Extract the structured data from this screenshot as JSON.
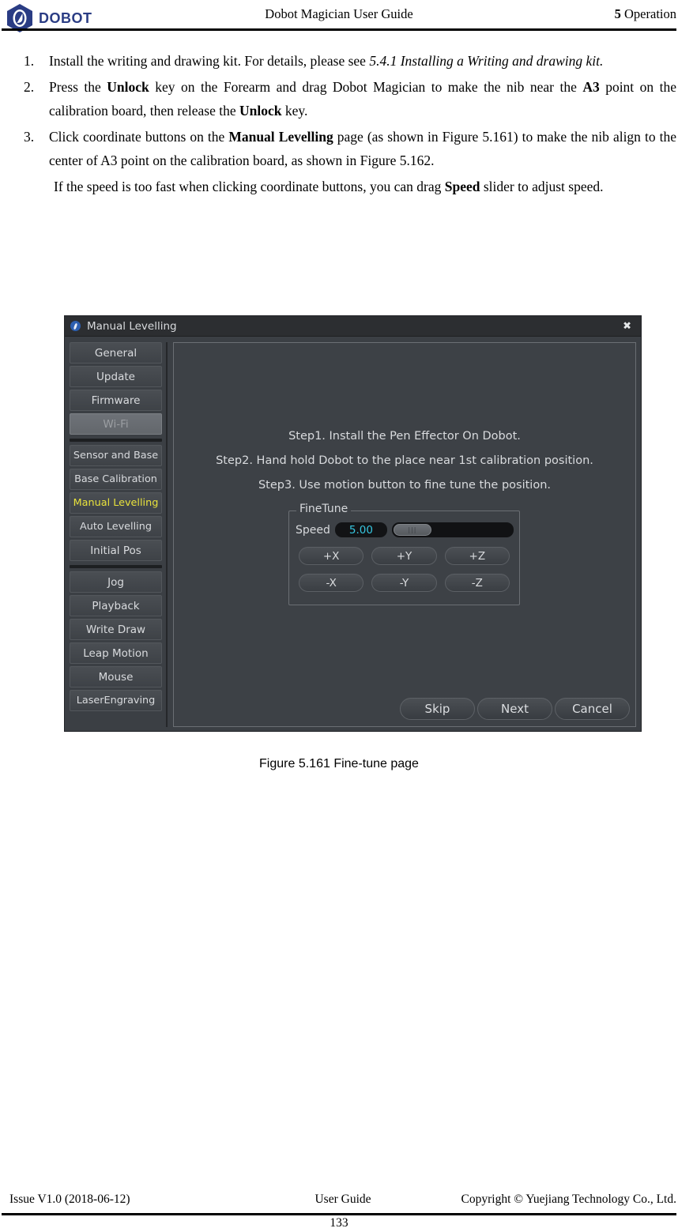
{
  "header": {
    "logo_text": "DOBOT",
    "logo_icon": "dobot-hexagon-logo",
    "title": "Dobot Magician User Guide",
    "chapter_number": "5",
    "chapter_name": "Operation"
  },
  "steps": [
    {
      "num": "1.",
      "parts": [
        {
          "text": "Install the writing and drawing kit. For details, please see",
          "style": "normal"
        },
        {
          "text": " 5.4.1 Installing a Writing and drawing kit.",
          "style": "italic"
        }
      ]
    },
    {
      "num": "2.",
      "parts": [
        {
          "text": "Press the ",
          "style": "normal"
        },
        {
          "text": "Unlock",
          "style": "bold"
        },
        {
          "text": " key on the Forearm and drag Dobot Magician to make the nib near the ",
          "style": "normal"
        },
        {
          "text": "A3",
          "style": "bold"
        },
        {
          "text": " point on the calibration board, then release the ",
          "style": "normal"
        },
        {
          "text": "Unlock",
          "style": "bold"
        },
        {
          "text": " key.",
          "style": "normal"
        }
      ]
    },
    {
      "num": "3.",
      "parts": [
        {
          "text": "Click coordinate buttons on the ",
          "style": "normal"
        },
        {
          "text": "Manual Levelling",
          "style": "bold"
        },
        {
          "text": " page (as shown in Figure 5.161) to make the nib align to the center of A3 point on the calibration board, as shown in Figure 5.162.",
          "style": "normal"
        }
      ]
    }
  ],
  "note": {
    "parts": [
      {
        "text": "If the speed is too fast when clicking coordinate buttons, you can drag ",
        "style": "normal"
      },
      {
        "text": "Speed",
        "style": "bold"
      },
      {
        "text": " slider to adjust speed.",
        "style": "normal"
      }
    ]
  },
  "app": {
    "titlebar": {
      "icon": "dobot-app-icon",
      "title": "Manual Levelling",
      "close_label": "✖"
    },
    "sidebar_groups": [
      {
        "items": [
          {
            "label": "General",
            "state": "normal"
          },
          {
            "label": "Update",
            "state": "normal"
          },
          {
            "label": "Firmware",
            "state": "normal"
          },
          {
            "label": "Wi-Fi",
            "state": "disabled"
          }
        ]
      },
      {
        "items": [
          {
            "label": "Sensor and Base",
            "state": "normal"
          },
          {
            "label": "Base Calibration",
            "state": "normal"
          },
          {
            "label": "Manual Levelling",
            "state": "active"
          },
          {
            "label": "Auto Levelling",
            "state": "normal"
          },
          {
            "label": "Initial Pos",
            "state": "normal"
          }
        ]
      },
      {
        "items": [
          {
            "label": "Jog",
            "state": "normal"
          },
          {
            "label": "Playback",
            "state": "normal"
          },
          {
            "label": "Write  Draw",
            "state": "normal"
          },
          {
            "label": "Leap Motion",
            "state": "normal"
          },
          {
            "label": "Mouse",
            "state": "normal"
          },
          {
            "label": "LaserEngraving",
            "state": "normal"
          }
        ]
      }
    ],
    "instructions": [
      "Step1. Install the Pen Effector On Dobot.",
      "Step2. Hand hold Dobot to the place near 1st calibration position.",
      "Step3. Use motion button to fine tune the position."
    ],
    "finetune": {
      "legend": "FineTune",
      "speed_label": "Speed",
      "speed_value": "5.00",
      "speed_value_color": "#36c6e0",
      "slider_position_percent": 2,
      "axis_buttons": [
        "+X",
        "+Y",
        "+Z",
        "-X",
        "-Y",
        "-Z"
      ]
    },
    "action_buttons": [
      {
        "label": "Skip"
      },
      {
        "label": "Next"
      },
      {
        "label": "Cancel"
      }
    ]
  },
  "figure_caption": "Figure 5.161 Fine-tune page",
  "footer": {
    "left": "Issue V1.0 (2018-06-12)",
    "center": "User Guide",
    "right": "Copyright © Yuejiang Technology Co., Ltd.",
    "page_number": "133"
  }
}
